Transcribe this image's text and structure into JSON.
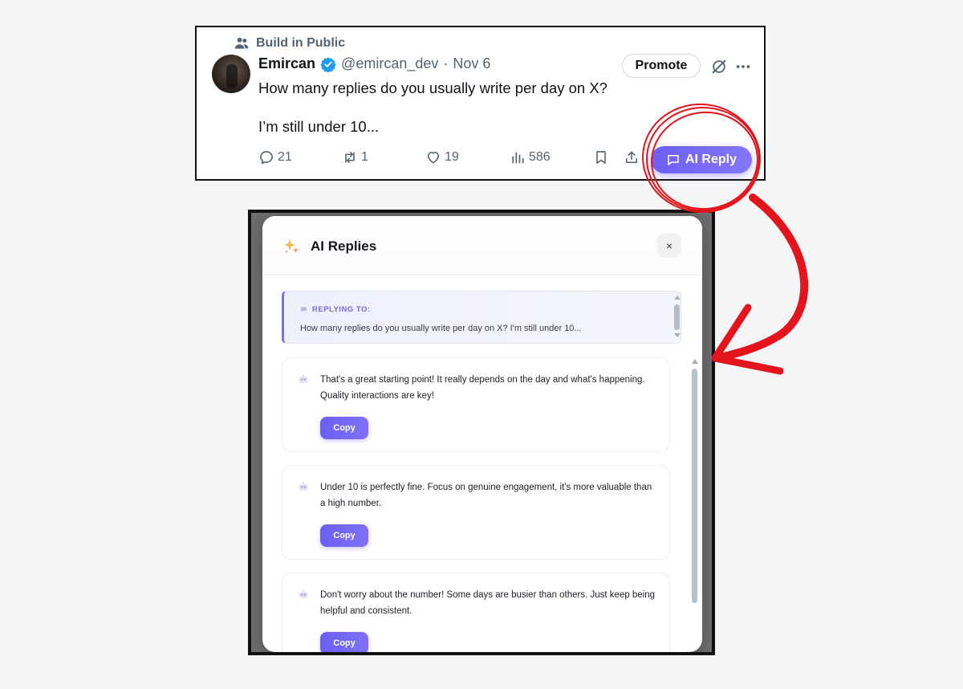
{
  "tweet": {
    "social_context": "Build in Public",
    "author_name": "Emircan",
    "handle": "@emircan_dev",
    "separator": "·",
    "date": "Nov 6",
    "promote_label": "Promote",
    "text": "How many replies do you usually write per day on X?\n\nI’m still under 10...",
    "stats": {
      "replies": "21",
      "reposts": "1",
      "likes": "19",
      "views": "586"
    },
    "ai_reply_label": "AI Reply"
  },
  "modal": {
    "title": "AI Replies",
    "close_label": "×",
    "replying_to_label": "REPLYING TO:",
    "replying_to_text": "How many replies do you usually write per day on X? I'm still under 10...",
    "replies": [
      {
        "text": "That's a great starting point! It really depends on the day and what's happening. Quality interactions are key!",
        "copy_label": "Copy"
      },
      {
        "text": "Under 10 is perfectly fine. Focus on genuine engagement, it's more valuable than a high number.",
        "copy_label": "Copy"
      },
      {
        "text": "Don't worry about the number! Some days are busier than others. Just keep being helpful and consistent.",
        "copy_label": "Copy"
      }
    ]
  },
  "colors": {
    "accent": "#6d5ef5",
    "annotation_red": "#e3141b",
    "text_primary": "#0f1419",
    "text_secondary": "#536471",
    "verified_blue": "#1d9bf0"
  },
  "icons": [
    "community-icon",
    "verified-badge-icon",
    "grok-icon",
    "more-icon",
    "reply-icon",
    "repost-icon",
    "like-icon",
    "views-icon",
    "bookmark-icon",
    "share-icon",
    "ai-chat-icon",
    "sparkle-icon",
    "chat-bubble-icon",
    "bot-icon"
  ]
}
